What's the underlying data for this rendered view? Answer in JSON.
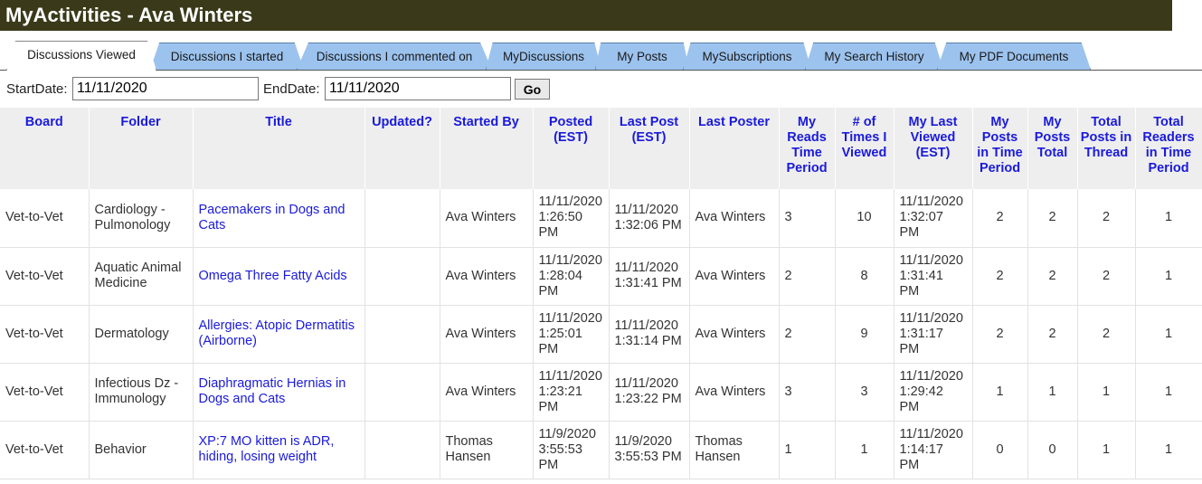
{
  "app": {
    "title": "MyActivities - Ava Winters"
  },
  "tabs": [
    {
      "label": "Discussions Viewed",
      "active": true
    },
    {
      "label": "Discussions I started",
      "active": false
    },
    {
      "label": "Discussions I commented on",
      "active": false
    },
    {
      "label": "MyDiscussions",
      "active": false
    },
    {
      "label": "My Posts",
      "active": false
    },
    {
      "label": "MySubscriptions",
      "active": false
    },
    {
      "label": "My Search History",
      "active": false
    },
    {
      "label": "My PDF Documents",
      "active": false
    }
  ],
  "filters": {
    "start_label": "StartDate:",
    "start_value": "11/11/2020",
    "end_label": "EndDate:",
    "end_value": "11/11/2020",
    "go_label": "Go"
  },
  "table": {
    "headers": [
      "Board",
      "Folder",
      "Title",
      "Updated?",
      "Started By",
      "Posted (EST)",
      "Last Post (EST)",
      "Last Poster",
      "My Reads Time Period",
      "# of Times I Viewed",
      "My Last Viewed (EST)",
      "My Posts in Time Period",
      "My Posts Total",
      "Total Posts in Thread",
      "Total Readers in Time Period"
    ],
    "rows": [
      [
        "Vet-to-Vet",
        "Cardiology - Pulmonology",
        "Pacemakers in Dogs and Cats",
        "",
        "Ava Winters",
        "11/11/2020 1:26:50 PM",
        "11/11/2020 1:32:06 PM",
        "Ava Winters",
        "3",
        "10",
        "11/11/2020 1:32:07 PM",
        "2",
        "2",
        "2",
        "1"
      ],
      [
        "Vet-to-Vet",
        "Aquatic Animal Medicine",
        "Omega Three Fatty Acids",
        "",
        "Ava Winters",
        "11/11/2020 1:28:04 PM",
        "11/11/2020 1:31:41 PM",
        "Ava Winters",
        "2",
        "8",
        "11/11/2020 1:31:41 PM",
        "2",
        "2",
        "2",
        "1"
      ],
      [
        "Vet-to-Vet",
        "Dermatology",
        "Allergies: Atopic Dermatitis (Airborne)",
        "",
        "Ava Winters",
        "11/11/2020 1:25:01 PM",
        "11/11/2020 1:31:14 PM",
        "Ava Winters",
        "2",
        "9",
        "11/11/2020 1:31:17 PM",
        "2",
        "2",
        "2",
        "1"
      ],
      [
        "Vet-to-Vet",
        "Infectious Dz - Immunology",
        "Diaphragmatic Hernias in Dogs and Cats",
        "",
        "Ava Winters",
        "11/11/2020 1:23:21 PM",
        "11/11/2020 1:23:22 PM",
        "Ava Winters",
        "3",
        "3",
        "11/11/2020 1:29:42 PM",
        "1",
        "1",
        "1",
        "1"
      ],
      [
        "Vet-to-Vet",
        "Behavior",
        "XP:7 MO kitten is ADR, hiding, losing weight",
        "",
        "Thomas Hansen",
        "11/9/2020 3:55:53 PM",
        "11/9/2020 3:55:53 PM",
        "Thomas Hansen",
        "1",
        "1",
        "11/11/2020 1:14:17 PM",
        "0",
        "0",
        "1",
        "1"
      ]
    ]
  }
}
